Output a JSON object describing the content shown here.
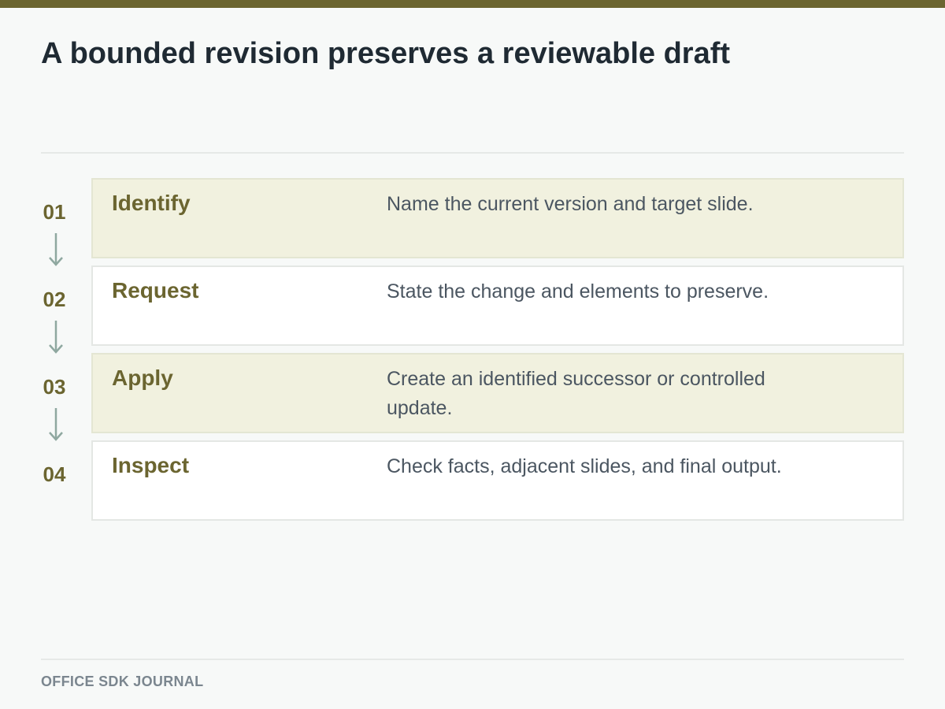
{
  "slide": {
    "title": "A bounded revision preserves a reviewable draft",
    "footer": "OFFICE SDK JOURNAL",
    "accent_color": "#6b6530",
    "shaded_card_color": "#f1f1df",
    "arrow_color": "#8fa8a0",
    "arrow_icon": "arrow-down-icon"
  },
  "steps": [
    {
      "number": "01",
      "label": "Identify",
      "description": "Name the current version and target slide."
    },
    {
      "number": "02",
      "label": "Request",
      "description": "State the change and elements to preserve."
    },
    {
      "number": "03",
      "label": "Apply",
      "description": "Create an identified successor or controlled update."
    },
    {
      "number": "04",
      "label": "Inspect",
      "description": "Check facts, adjacent slides, and final output."
    }
  ]
}
